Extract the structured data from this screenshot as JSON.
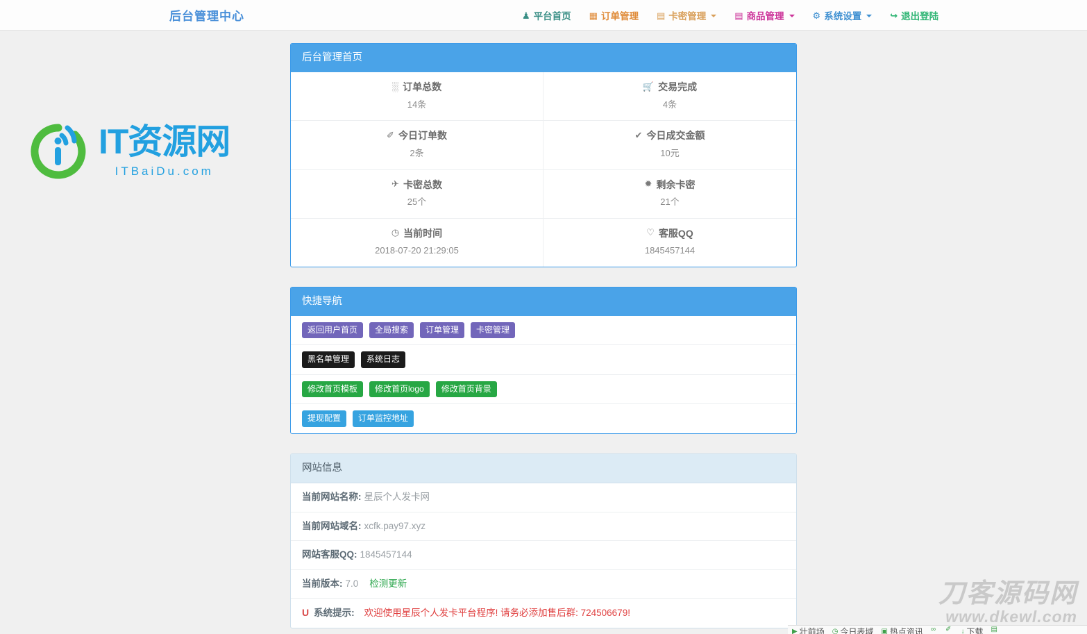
{
  "navbar": {
    "brand": "后台管理中心",
    "items": [
      {
        "label": "平台首页",
        "icon": "user-icon",
        "glyph": "♟",
        "color": "#3a8f86",
        "caret": false
      },
      {
        "label": "订单管理",
        "icon": "calendar-icon",
        "glyph": "▦",
        "color": "#e08c3a",
        "caret": false
      },
      {
        "label": "卡密管理",
        "icon": "book-icon",
        "glyph": "▤",
        "color": "#d9a05b",
        "caret": true
      },
      {
        "label": "商品管理",
        "icon": "book-icon",
        "glyph": "▤",
        "color": "#cc3399",
        "caret": true
      },
      {
        "label": "系统设置",
        "icon": "gear-icon",
        "glyph": "⚙",
        "color": "#3d8fd1",
        "caret": true
      },
      {
        "label": "退出登陆",
        "icon": "logout-icon",
        "glyph": "↪",
        "color": "#2fb574",
        "caret": false
      }
    ]
  },
  "dashboard": {
    "title": "后台管理首页",
    "stats": [
      {
        "label": "订单总数",
        "icon": "grid-icon",
        "glyph": "░",
        "value": "14条"
      },
      {
        "label": "交易完成",
        "icon": "cart-icon",
        "glyph": "🛒",
        "value": "4条"
      },
      {
        "label": "今日订单数",
        "icon": "leaf-icon",
        "glyph": "✐",
        "value": "2条"
      },
      {
        "label": "今日成交金额",
        "icon": "check-icon",
        "glyph": "✔",
        "value": "10元"
      },
      {
        "label": "卡密总数",
        "icon": "plane-icon",
        "glyph": "✈",
        "value": "25个"
      },
      {
        "label": "剩余卡密",
        "icon": "asterisk-icon",
        "glyph": "✹",
        "value": "21个"
      },
      {
        "label": "当前时间",
        "icon": "clock-icon",
        "glyph": "◷",
        "value": "2018-07-20 21:29:05"
      },
      {
        "label": "客服QQ",
        "icon": "heart-icon",
        "glyph": "♡",
        "value": "1845457144"
      }
    ]
  },
  "quicknav": {
    "title": "快捷导航",
    "rows": [
      {
        "style": "btn-purple",
        "buttons": [
          "返回用户首页",
          "全局搜索",
          "订单管理",
          "卡密管理"
        ]
      },
      {
        "style": "btn-dark",
        "buttons": [
          "黑名单管理",
          "系统日志"
        ]
      },
      {
        "style": "btn-green",
        "buttons": [
          "修改首页模板",
          "修改首页logo",
          "修改首页背景"
        ]
      },
      {
        "style": "btn-blue",
        "buttons": [
          "提现配置",
          "订单监控地址"
        ]
      }
    ]
  },
  "siteinfo": {
    "title": "网站信息",
    "rows": [
      {
        "label": "当前网站名称:",
        "value": "星辰个人发卡网"
      },
      {
        "label": "当前网站域名:",
        "value": "xcfk.pay97.xyz"
      },
      {
        "label": "网站客服QQ:",
        "value": "1845457144"
      }
    ],
    "version_label": "当前版本:",
    "version_value": "7.0",
    "version_link": "检测更新",
    "tip_label": "系统提示:",
    "tip_text": "欢迎使用星辰个人发卡平台程序! 请务必添加售后群: 724506679!"
  },
  "watermarks": {
    "left_main": "IT资源网",
    "left_sub": "ITBaiDu.com",
    "br_main": "刀客源码网",
    "br_sub": "www.dkewl.com"
  },
  "bottom_strip": {
    "items": [
      {
        "icon": "video-icon",
        "glyph": "▶",
        "label": "壮前场"
      },
      {
        "icon": "clock-icon",
        "glyph": "◷",
        "label": "今日表域"
      },
      {
        "icon": "video2-icon",
        "glyph": "▣",
        "label": "热点资讯"
      },
      {
        "icon": "link-icon",
        "glyph": "∞",
        "label": ""
      },
      {
        "icon": "pen-icon",
        "glyph": "✐",
        "label": ""
      },
      {
        "icon": "down-icon",
        "glyph": "↓",
        "label": "下载"
      },
      {
        "icon": "grid2-icon",
        "glyph": "▤",
        "label": ""
      }
    ]
  }
}
